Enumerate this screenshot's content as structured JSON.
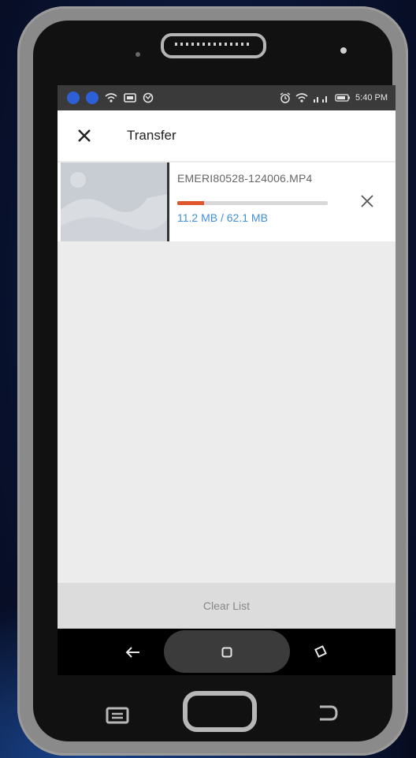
{
  "statusbar": {
    "time": "5:40 PM",
    "left_icons": [
      "notification-dot",
      "notification-dot",
      "wifi-icon",
      "cast-icon",
      "sync-icon"
    ],
    "right_icons": [
      "alarm-icon",
      "wifi-icon",
      "signal-icon",
      "battery-icon"
    ]
  },
  "appbar": {
    "title": "Transfer",
    "close_icon": "close-icon"
  },
  "transfer": {
    "file_name": "EMERI80528-124006.MP4",
    "progress_text": "11.2 MB / 62.1 MB",
    "progress_fraction": 0.18,
    "progress_color": "#e0552c",
    "progress_text_color": "#3f8fd8"
  },
  "footer": {
    "clear_label": "Clear List"
  },
  "navbar": {
    "back_icon": "back-icon",
    "home_icon": "home-icon",
    "recent_icon": "recent-apps-icon"
  }
}
